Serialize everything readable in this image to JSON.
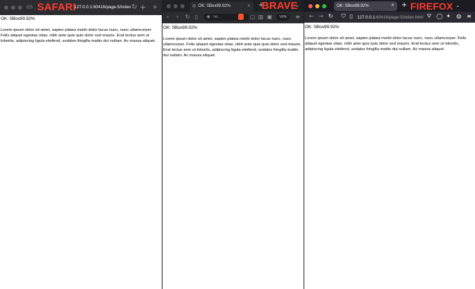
{
  "safari": {
    "brand": "SAFARI",
    "url": "127.0.0.1:60416/page-5/index.h",
    "status": "OK: SBox99.92%",
    "paragraph": "Lorem ipsum dolor sit amet, sapien platea morbi dolor lacus nunc, nunc ullamcorper. Felis aliquet egestas vitae, nibh ante quis quis dolor sed mauris. Erat lectus sem ut lobortis, adipiscing ligula eleifend, sodales fringilla mattis dui nullam. Ac massa aliquet."
  },
  "brave": {
    "brand": "BRAVE",
    "tab_title": "OK: SBox99.92%",
    "address": "htt...",
    "vpn_label": "VPN",
    "status": "OK: SBox99.92%",
    "paragraph": "Lorem ipsum dolor sit amet, sapien platea morbi dolor lacus nunc, nunc ullamcorper. Felis aliquet egestas vitae, nibh ante quis quis dolor sed mauris. Erat lectus sem ut lobortis, adipiscing ligula eleifend, sodales fringilla mattis dui nullam. Ac massa aliquet."
  },
  "firefox": {
    "brand": "FIREFOX",
    "tab_title": "OK: SBox99.92%",
    "url_host": "127.0.0.1",
    "url_path": ":60416/page-5/index.html",
    "status": "OK: SBox99.92%",
    "paragraph": "Lorem ipsum dolor sit amet, sapien platea morbi dolor lacus nunc, nunc ullamcorper. Felis aliquet egestas vitae, nibh ante quis quis dolor sed mauris. Erat lectus sem ut lobortis, adipiscing ligula eleifend, sodales fringilla mattis dui nullam. Ac massa aliquet."
  },
  "colors": {
    "brand_label": "#ff3b2f",
    "firefox_close": "#ff5f57",
    "firefox_min": "#febc2e",
    "firefox_max": "#28c840",
    "brave_lion": "#fb542b"
  },
  "icons": [
    "sidebar-icon",
    "chevron-down-icon",
    "reload-icon",
    "plus-icon",
    "back-icon",
    "forward-icon",
    "bookmark-icon",
    "shield-icon",
    "tabs-icon",
    "account-icon",
    "extensions-icon",
    "menu-icon"
  ]
}
